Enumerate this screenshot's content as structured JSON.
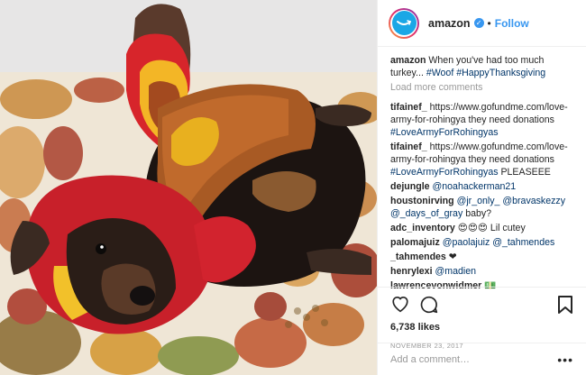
{
  "post": {
    "username": "amazon",
    "verified_icon": "verified-badge-icon",
    "separator": "•",
    "follow_label": "Follow",
    "caption_user": "amazon",
    "caption_text": "When you've had too much turkey... ",
    "caption_tags": "#Woof #HappyThanksgiving",
    "load_more": "Load more comments"
  },
  "comments": [
    {
      "user": "tifainef_",
      "text": "https://www.gofundme.com/love-army-for-rohingya they need donations ",
      "tag": "#LoveArmyForRohingyas",
      "tail": ""
    },
    {
      "user": "tifainef_",
      "text": "https://www.gofundme.com/love-army-for-rohingya they need donations ",
      "tag": "#LoveArmyForRohingyas",
      "tail": " PLEASEEE"
    },
    {
      "user": "dejungle",
      "text": "",
      "tag": "@noahackerman21",
      "tail": ""
    },
    {
      "user": "houstonirving",
      "text": "",
      "tag": "@jr_only_ @bravaskezzy @_days_of_gray",
      "tail": " baby?"
    },
    {
      "user": "adc_inventory",
      "text": "😍😍😍",
      "tag": "",
      "tail": " Lil cutey"
    },
    {
      "user": "palomajuiz",
      "text": "",
      "tag": "@paolajuiz @_tahmendes",
      "tail": ""
    },
    {
      "user": "_tahmendes",
      "text": "❤",
      "tag": "",
      "tail": ""
    },
    {
      "user": "henrylexi",
      "text": "",
      "tag": "@madien",
      "tail": ""
    },
    {
      "user": "lawrencevonwidmer",
      "text": "💵",
      "tag": "",
      "tail": ""
    }
  ],
  "actions": {
    "like_icon": "heart-icon",
    "comment_icon": "comment-icon",
    "save_icon": "bookmark-icon",
    "likes": "6,738 likes",
    "date": "NOVEMBER 23, 2017"
  },
  "add_comment": {
    "placeholder": "Add a comment…",
    "more_label": "•••"
  },
  "colors": {
    "accent": "#3897f0",
    "hashtag": "#003569",
    "muted": "#999999"
  }
}
